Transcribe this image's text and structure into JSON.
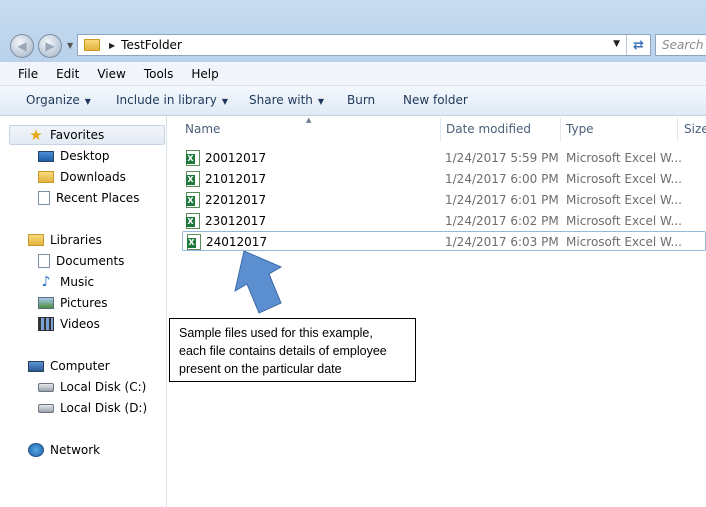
{
  "window": {
    "breadcrumb": "TestFolder",
    "search_placeholder": "Search T"
  },
  "menu": [
    "File",
    "Edit",
    "View",
    "Tools",
    "Help"
  ],
  "toolbar": {
    "organize": "Organize",
    "include_in_library": "Include in library",
    "share_with": "Share with",
    "burn": "Burn",
    "new_folder": "New folder"
  },
  "nav": {
    "favorites": "Favorites",
    "desktop": "Desktop",
    "downloads": "Downloads",
    "recent_places": "Recent Places",
    "libraries": "Libraries",
    "documents": "Documents",
    "music": "Music",
    "pictures": "Pictures",
    "videos": "Videos",
    "computer": "Computer",
    "local_disk_c": "Local Disk (C:)",
    "local_disk_d": "Local Disk (D:)",
    "network": "Network"
  },
  "columns": {
    "name": "Name",
    "date_modified": "Date modified",
    "type": "Type",
    "size": "Size"
  },
  "files": [
    {
      "name": "20012017",
      "date": "1/24/2017 5:59 PM",
      "type": "Microsoft Excel W..."
    },
    {
      "name": "21012017",
      "date": "1/24/2017 6:00 PM",
      "type": "Microsoft Excel W..."
    },
    {
      "name": "22012017",
      "date": "1/24/2017 6:01 PM",
      "type": "Microsoft Excel W..."
    },
    {
      "name": "23012017",
      "date": "1/24/2017 6:02 PM",
      "type": "Microsoft Excel W..."
    },
    {
      "name": "24012017",
      "date": "1/24/2017 6:03 PM",
      "type": "Microsoft Excel W..."
    }
  ],
  "callout": {
    "line1": "Sample files used for this example,",
    "line2": "each file contains details of employee",
    "line3": "present on the particular date"
  },
  "colors": {
    "arrow": "#5b8fd0",
    "arrow_border": "#3d6aa8"
  }
}
